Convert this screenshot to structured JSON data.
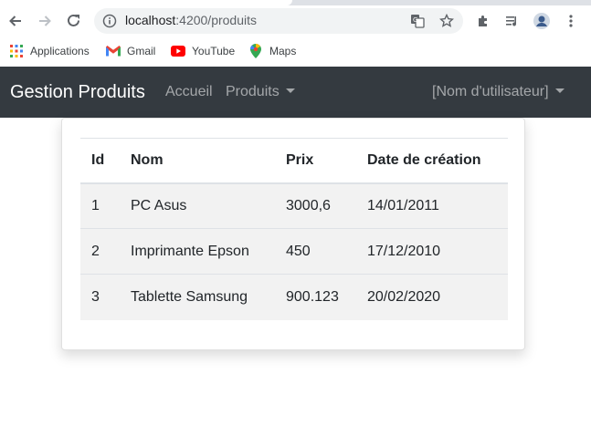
{
  "browser": {
    "url_host": "localhost",
    "url_path": ":4200/produits"
  },
  "bookmarks": [
    {
      "label": "Applications",
      "icon": "apps-grid-icon"
    },
    {
      "label": "Gmail",
      "icon": "gmail-icon"
    },
    {
      "label": "YouTube",
      "icon": "youtube-icon"
    },
    {
      "label": "Maps",
      "icon": "maps-icon"
    }
  ],
  "navbar": {
    "brand": "Gestion Produits",
    "home": "Accueil",
    "products": "Produits",
    "user": "[Nom d'utilisateur]",
    "background": "#343a40"
  },
  "table": {
    "headers": [
      "Id",
      "Nom",
      "Prix",
      "Date de création"
    ],
    "rows": [
      [
        "1",
        "PC Asus",
        "3000,6",
        "14/01/2011"
      ],
      [
        "2",
        "Imprimante Epson",
        "450",
        "17/12/2010"
      ],
      [
        "3",
        "Tablette Samsung",
        "900.123",
        "20/02/2020"
      ]
    ]
  }
}
